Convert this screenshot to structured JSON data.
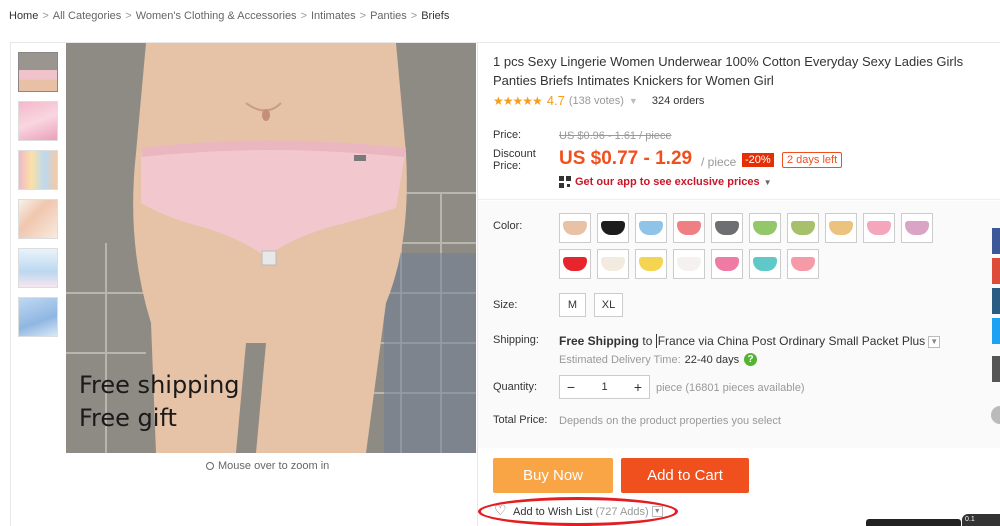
{
  "breadcrumb": [
    "Home",
    "All Categories",
    "Women's Clothing & Accessories",
    "Intimates",
    "Panties",
    "Briefs"
  ],
  "breadcrumb_separator": ">",
  "gallery": {
    "photo_overlay_line1": "Free shipping",
    "photo_overlay_line2": "Free gift",
    "zoom_hint": "Mouse over to zoom in"
  },
  "product": {
    "title": "1 pcs Sexy Lingerie Women Underwear 100% Cotton Everyday Sexy Ladies Girls Panties Briefs Intimates Knickers for Women Girl",
    "stars": "★★★★★",
    "rating": "4.7",
    "votes": "(138 votes)",
    "orders": "324 orders"
  },
  "pricing": {
    "price_label": "Price:",
    "original_price": "US $0.96 - 1.61 / piece",
    "discount_label_line1": "Discount",
    "discount_label_line2": "Price:",
    "discount_price": "US $0.77 - 1.29",
    "per_unit": "/ piece",
    "discount_badge": "-20%",
    "days_left": "2 days left",
    "app_promo": "Get our app to see exclusive prices"
  },
  "options": {
    "color_label": "Color:",
    "colors": [
      "#e9c2a6",
      "#1c1c1c",
      "#8fc3e8",
      "#f07f84",
      "#6d6e72",
      "#93c86a",
      "#a7c06c",
      "#ecc27f",
      "#f4a6bd",
      "#d9a4c6",
      "#e8242c",
      "#f3ebe0",
      "#f4d451",
      "#f6f1f1",
      "#ef7aa3",
      "#5fc8c9",
      "#f59aa6"
    ],
    "size_label": "Size:",
    "sizes": [
      "M",
      "XL"
    ],
    "shipping_label": "Shipping:",
    "shipping_free": "Free Shipping",
    "shipping_to": "to",
    "shipping_dest": "France via China Post Ordinary Small Packet Plus",
    "estimated_label": "Estimated Delivery Time:",
    "estimated_days": "22-40 days",
    "quantity_label": "Quantity:",
    "quantity_value": "1",
    "availability": "piece (16801 pieces available)",
    "total_label": "Total Price:",
    "total_text": "Depends on the product properties you select"
  },
  "actions": {
    "buy_now": "Buy Now",
    "add_to_cart": "Add to Cart",
    "wish_label": "Add to Wish List",
    "wish_count": "(727 Adds)"
  },
  "side_social_colors": [
    "#3b5998",
    "#dd4b39",
    "#2a5b83",
    "#1da1f2",
    "#555555"
  ],
  "corner_badge": "0.1"
}
